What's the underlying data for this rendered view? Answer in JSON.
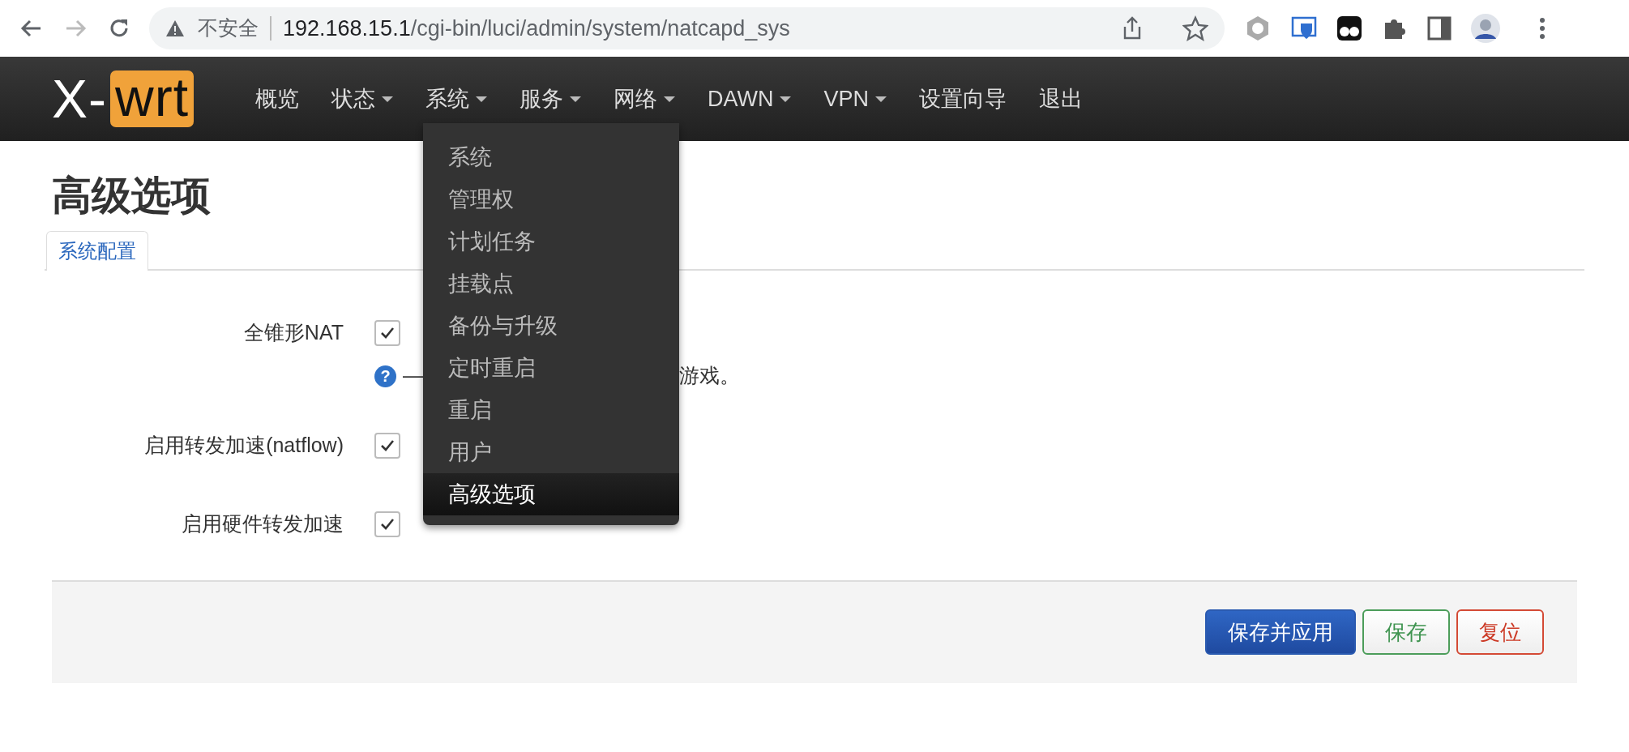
{
  "browser": {
    "security": "不安全",
    "url_host": "192.168.15.1",
    "url_path": "/cgi-bin/luci/admin/system/natcapd_sys"
  },
  "brand": {
    "prefix": "X-",
    "highlight": "wrt"
  },
  "nav": [
    {
      "label": "概览",
      "caret": false
    },
    {
      "label": "状态",
      "caret": true
    },
    {
      "label": "系统",
      "caret": true
    },
    {
      "label": "服务",
      "caret": true
    },
    {
      "label": "网络",
      "caret": true
    },
    {
      "label": "DAWN",
      "caret": true
    },
    {
      "label": "VPN",
      "caret": true
    },
    {
      "label": "设置向导",
      "caret": false
    },
    {
      "label": "退出",
      "caret": false
    }
  ],
  "dropdown": [
    {
      "label": "系统",
      "selected": false
    },
    {
      "label": "管理权",
      "selected": false
    },
    {
      "label": "计划任务",
      "selected": false
    },
    {
      "label": "挂载点",
      "selected": false
    },
    {
      "label": "备份与升级",
      "selected": false
    },
    {
      "label": "定时重启",
      "selected": false
    },
    {
      "label": "重启",
      "selected": false
    },
    {
      "label": "用户",
      "selected": false
    },
    {
      "label": "高级选项",
      "selected": true
    }
  ],
  "page_title": "高级选项",
  "tabs": [
    {
      "label": "系统配置",
      "selected": true
    }
  ],
  "options": [
    {
      "label": "全锥形NAT",
      "checked": true,
      "help": {
        "icon": "?",
        "prefix": "—",
        "suffix": "游戏。"
      }
    },
    {
      "label": "启用转发加速(natflow)",
      "checked": true
    },
    {
      "label": "启用硬件转发加速",
      "checked": true
    }
  ],
  "buttons": [
    {
      "label": "保存并应用",
      "kind": "apply"
    },
    {
      "label": "保存",
      "kind": "save"
    },
    {
      "label": "复位",
      "kind": "reset"
    }
  ]
}
